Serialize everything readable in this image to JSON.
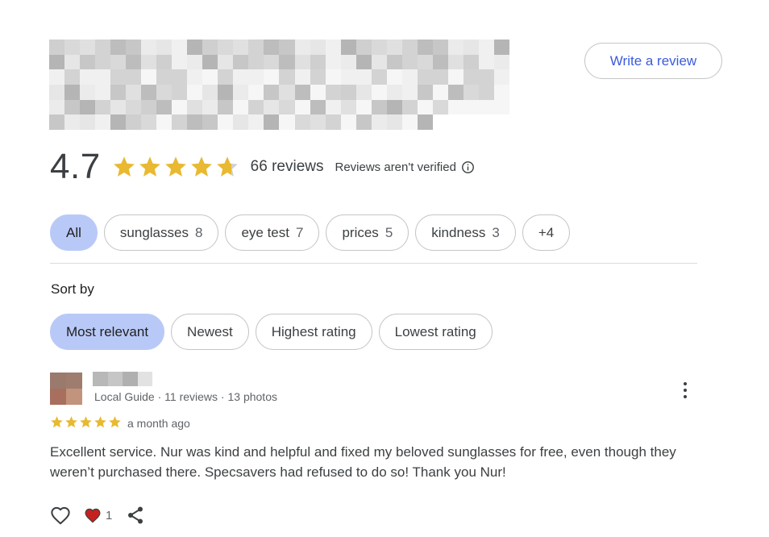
{
  "header": {
    "write_review_label": "Write a review"
  },
  "summary": {
    "rating": "4.7",
    "rating_value": 4.7,
    "review_count": "66 reviews",
    "verification_note": "Reviews aren't verified",
    "star_color": "#e8b931"
  },
  "topics": [
    {
      "label": "All",
      "count": ""
    },
    {
      "label": "sunglasses",
      "count": "8"
    },
    {
      "label": "eye test",
      "count": "7"
    },
    {
      "label": "prices",
      "count": "5"
    },
    {
      "label": "kindness",
      "count": "3"
    },
    {
      "label": "+4",
      "count": ""
    }
  ],
  "sort": {
    "label": "Sort by",
    "options": [
      "Most relevant",
      "Newest",
      "Highest rating",
      "Lowest rating"
    ],
    "selected": "Most relevant"
  },
  "review": {
    "author_meta": "Local Guide · 11 reviews · 13 photos",
    "stars": 5,
    "date": "a month ago",
    "text": "Excellent service. Nur was kind and helpful and fixed my beloved sunglasses for free, even though they weren’t purchased there. Specsavers had refused to do so! Thank you Nur!",
    "reaction_count": "1"
  },
  "colors": {
    "accent_chip": "#b9c9f7",
    "link_blue": "#3b5bdb",
    "heart_red": "#c5221f"
  }
}
